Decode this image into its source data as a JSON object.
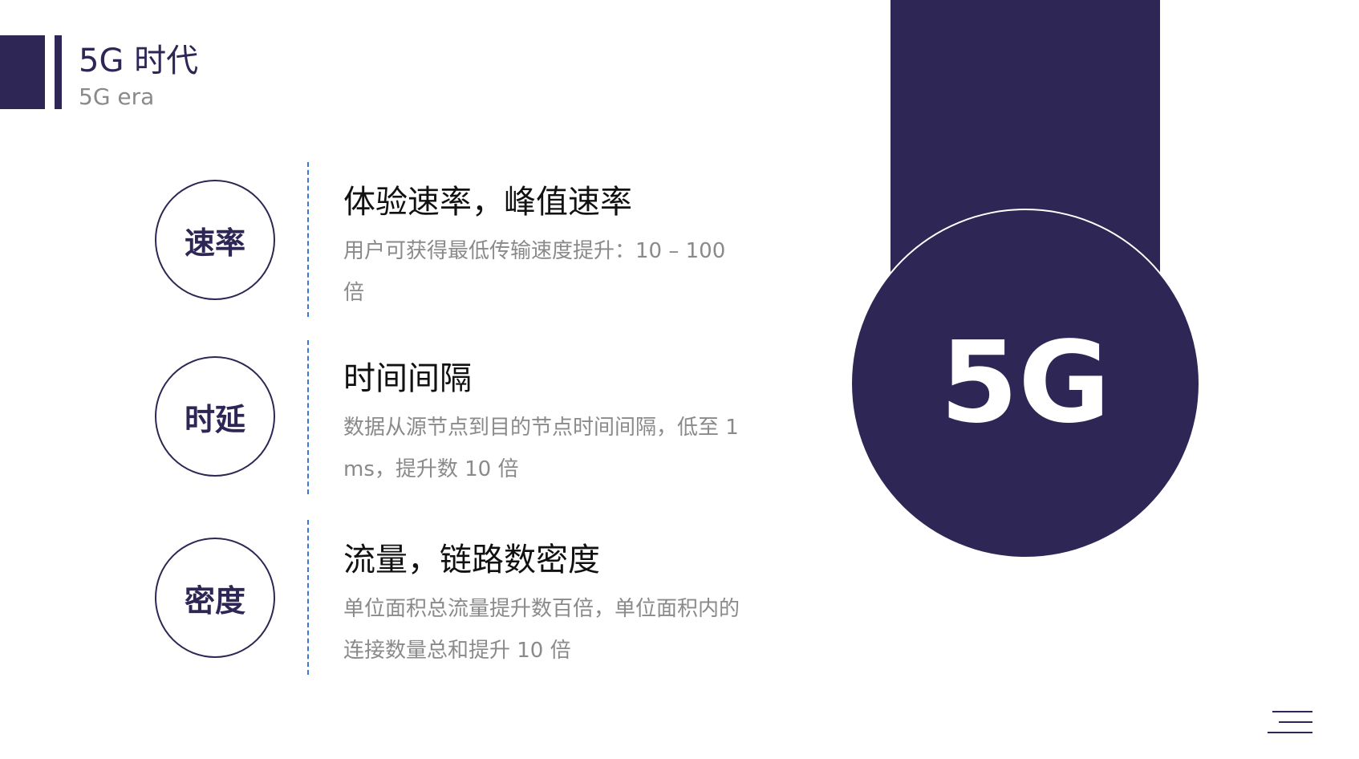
{
  "header": {
    "title": "5G 时代",
    "subtitle": "5G era"
  },
  "rows": [
    {
      "badge": "速率",
      "title": "体验速率，峰值速率",
      "desc": "用户可获得最低传输速度提升：10 – 100 倍"
    },
    {
      "badge": "时延",
      "title": "时间间隔",
      "desc": "数据从源节点到目的节点时间间隔，低至 1 ms，提升数 10 倍"
    },
    {
      "badge": "密度",
      "title": "流量，链路数密度",
      "desc": "单位面积总流量提升数百倍，单位面积内的连接数量总和提升 10 倍"
    }
  ],
  "graphic": {
    "label": "5G"
  },
  "colors": {
    "primary": "#2E2654",
    "accent_dash": "#3E78D6",
    "muted_text": "#8A8A8A"
  },
  "icons": {
    "menu": "menu-icon"
  }
}
